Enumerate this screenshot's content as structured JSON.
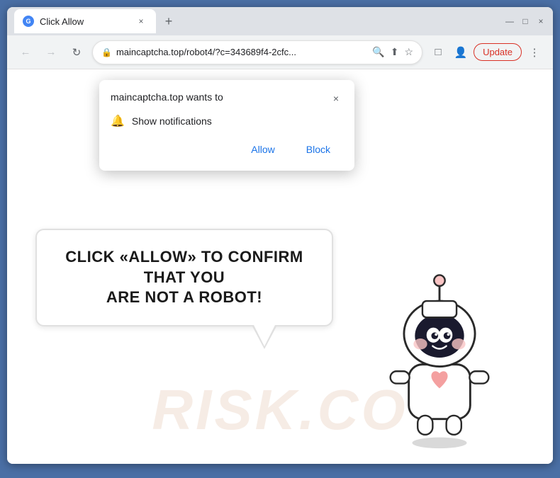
{
  "browser": {
    "window_title": "Click Allow",
    "tab": {
      "favicon_letter": "G",
      "title": "Click Allow",
      "close_label": "×"
    },
    "new_tab_label": "+",
    "window_controls": {
      "minimize": "—",
      "maximize": "□",
      "close": "×"
    },
    "nav": {
      "back_arrow": "←",
      "forward_arrow": "→",
      "reload": "↻",
      "url": "maincaptcha.top/robot4/?c=343689f4-2cfc...",
      "search_icon": "🔍",
      "share_icon": "⬆",
      "bookmark_icon": "☆",
      "extensions_icon": "□",
      "profile_icon": "👤",
      "update_label": "Update",
      "more_icon": "⋮"
    }
  },
  "notification_dialog": {
    "title": "maincaptcha.top wants to",
    "close_label": "×",
    "permission_label": "Show notifications",
    "allow_label": "Allow",
    "block_label": "Block"
  },
  "speech_bubble": {
    "line1": "CLICK «ALLOW» TO CONFIRM THAT YOU",
    "line2": "ARE NOT A ROBOT!"
  },
  "watermark": {
    "text": "RISK.CO"
  },
  "colors": {
    "browser_border": "#4a6fa5",
    "allow_button": "#1a73e8",
    "block_button": "#1a73e8",
    "update_button_border": "#d93025",
    "update_button_text": "#d93025"
  }
}
